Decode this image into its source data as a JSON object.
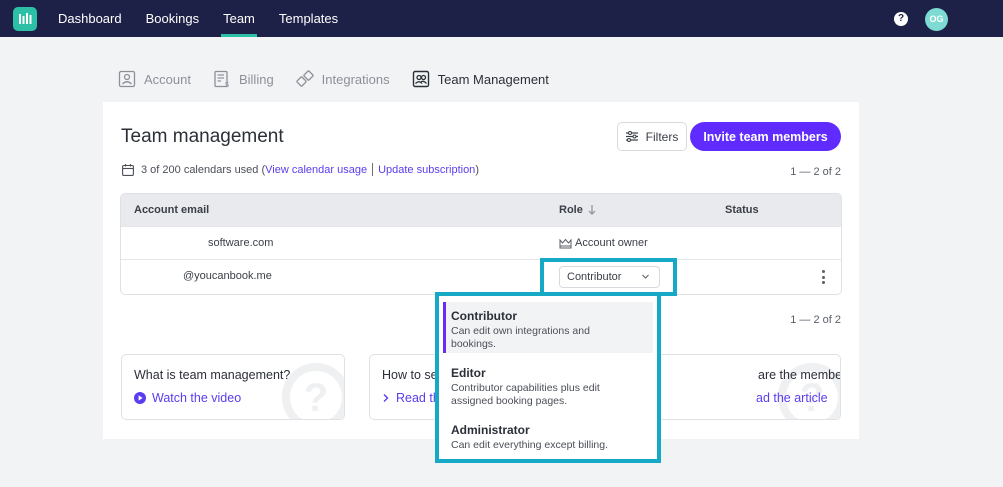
{
  "nav": {
    "items": [
      {
        "label": "Dashboard",
        "active": false
      },
      {
        "label": "Bookings",
        "active": false
      },
      {
        "label": "Team",
        "active": true
      },
      {
        "label": "Templates",
        "active": false
      }
    ],
    "help": "?",
    "avatar_initials": "OG"
  },
  "subtabs": [
    {
      "label": "Account",
      "icon": "user-icon"
    },
    {
      "label": "Billing",
      "icon": "billing-icon"
    },
    {
      "label": "Integrations",
      "icon": "integrations-icon"
    },
    {
      "label": "Team Management",
      "icon": "team-icon",
      "active": true
    }
  ],
  "card": {
    "title": "Team management",
    "filters_label": "Filters",
    "invite_label": "Invite team members",
    "usage_text": "3 of 200 calendars used",
    "open_paren": "(",
    "view_usage": "View calendar usage",
    "update_sub": "Update subscription",
    "close_paren": ")",
    "pager": "1 — 2 of 2"
  },
  "table": {
    "headers": {
      "email": "Account email",
      "role": "Role",
      "status": "Status"
    },
    "rows": [
      {
        "email": "software.com",
        "role": "Account owner"
      },
      {
        "email": "@youcanbook.me",
        "role": "Contributor"
      }
    ]
  },
  "info_cards": [
    {
      "question": "What is team management?",
      "link": "Watch the video"
    },
    {
      "question": "How to se",
      "link": "Read th"
    },
    {
      "question": "are the member roles?",
      "link": "ad the article"
    }
  ],
  "dropdown": {
    "options": [
      {
        "name": "Contributor",
        "desc": "Can edit own integrations and bookings.",
        "selected": true
      },
      {
        "name": "Editor",
        "desc": "Contributor capabilities plus edit assigned booking pages."
      },
      {
        "name": "Administrator",
        "desc": "Can edit everything except billing."
      }
    ]
  },
  "colors": {
    "nav_bg": "#1e2147",
    "accent": "#2cc1a7",
    "primary": "#5f2bff",
    "highlight": "#16a9c5"
  }
}
